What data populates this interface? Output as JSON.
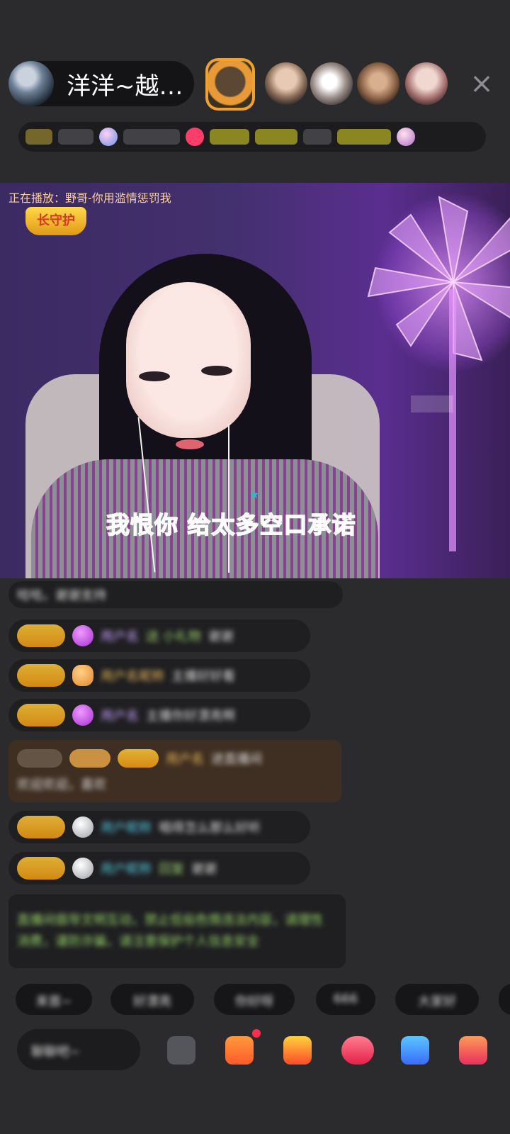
{
  "header": {
    "host_name": "洋洋~越…",
    "close_glyph": "×",
    "viewers": [
      "top-fan-avatar",
      "viewer-avatar",
      "viewer-avatar",
      "viewer-avatar",
      "viewer-avatar"
    ],
    "info_bar_items": [
      "badge",
      "text",
      "avatar-icon",
      "text",
      "avatar-icon",
      "yellow-tag",
      "yellow-tag",
      "text",
      "yellow-tag",
      "avatar-icon"
    ]
  },
  "video": {
    "now_playing": "正在播放：野哥-你用滥情惩罚我",
    "badge_text": "长守护",
    "lyrics": "我恨你  给太多空口承诺",
    "lyric_star": "★"
  },
  "chat": {
    "messages": [
      {
        "text": "哈哈。谢谢支持"
      },
      {
        "user": "用户名",
        "extra": "送 小礼物",
        "text": "谢谢"
      },
      {
        "user": "用户名昵称",
        "text": "主播好好看"
      },
      {
        "user": "用户名",
        "text": "主播你好漂亮啊"
      },
      {
        "user": "用户名",
        "text": "进直播间",
        "line2": "欢迎欢迎，喜欢"
      },
      {
        "user": "用户昵称",
        "text": "唱得怎么那么好听"
      },
      {
        "user": "用户昵称",
        "extra": "回复",
        "text": "谢谢"
      },
      {
        "text": "直播间倡导文明互动，禁止低俗色情违法内容，请理性消费，谨防诈骗，请注意保护个人信息安全"
      }
    ]
  },
  "quick_replies": [
    "来首~",
    "好漂亮",
    "你好呀",
    "666",
    "大家好"
  ],
  "bottom": {
    "input_placeholder": "聊聊吧~",
    "icons": [
      "more-icon",
      "gift-box-icon",
      "red-packet-icon",
      "heart-icon",
      "share-icon",
      "shop-icon"
    ]
  },
  "colors": {
    "background": "#2b2b2d",
    "lyrics": "#2fb8d6",
    "level_badge": "#f7b21d",
    "notification_dot": "#ff2e4d"
  }
}
